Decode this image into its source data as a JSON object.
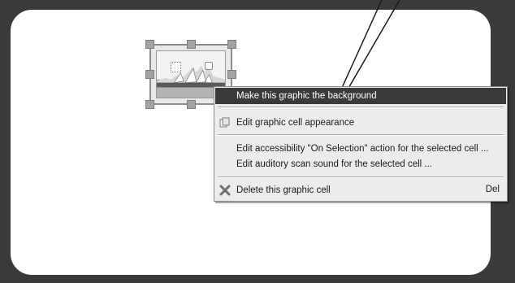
{
  "context_menu": {
    "items": [
      {
        "label": "Make this graphic the background",
        "highlighted": true,
        "icon": ""
      },
      {
        "label": "Edit graphic cell appearance",
        "icon": "copy-cells-icon"
      },
      {
        "label": "Edit accessibility \"On Selection\" action for the selected cell ...",
        "icon": ""
      },
      {
        "label": "Edit auditory scan sound for the selected cell ...",
        "icon": ""
      },
      {
        "label": "Delete this graphic cell",
        "shortcut": "Del",
        "icon": "delete-x-icon"
      }
    ]
  },
  "graphic_cell": {
    "image": "sydney-opera-house-photo",
    "selected": true
  },
  "colors": {
    "background_frame": "#3a3a3a",
    "panel": "#ffffff",
    "menu_background": "#ececec",
    "menu_highlight": "#3a3a3a"
  }
}
